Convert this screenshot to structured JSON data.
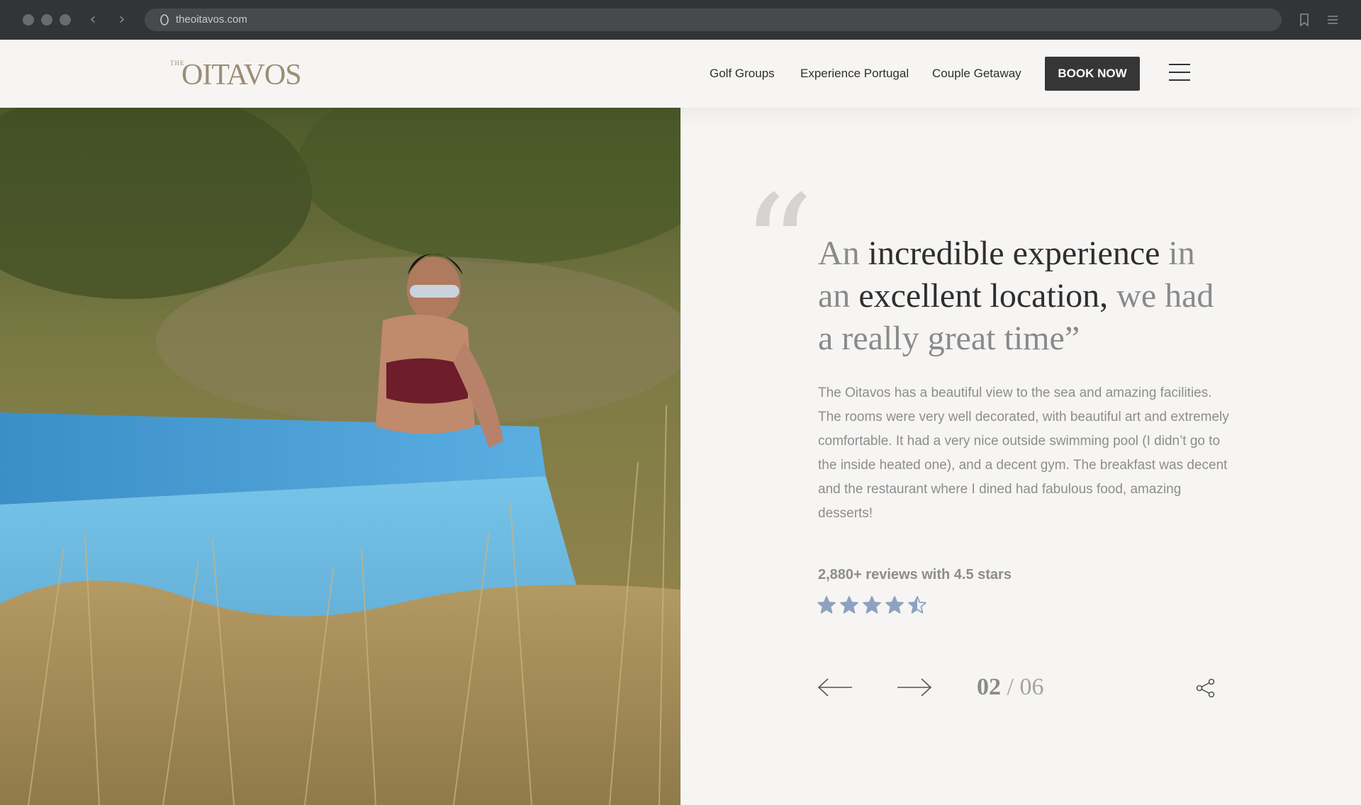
{
  "browser": {
    "url": "theoitavos.com"
  },
  "header": {
    "logo_small": "THE",
    "logo_main": "OITAVOS",
    "nav": [
      "Golf Groups",
      "Experience Portugal",
      "Couple Getaway"
    ],
    "book_label": "BOOK NOW"
  },
  "testimonial": {
    "quote_mark": "“",
    "quote_parts": [
      "An ",
      "incredible experience",
      " in an ",
      "excellent location,",
      " we had a really great time”"
    ],
    "review": "The Oitavos has a beautiful view to the sea and amazing facilities. The rooms were very well decorated, with beautiful art and extremely comfortable. It had a very nice outside swimming pool (I didn’t go to the inside heated one), and a decent gym. The breakfast was decent and the restaurant where I dined had fabulous food, amazing desserts!",
    "reviews_summary": "2,880+ reviews with 4.5 stars",
    "rating": 4.5,
    "rating_max": 5
  },
  "pager": {
    "current": "02",
    "separator": " / ",
    "total": "06"
  },
  "colors": {
    "accent": "#9b8e72",
    "button_bg": "#363636",
    "star": "#8ea2bf",
    "background": "#f6f5f3"
  },
  "icons": {
    "prev": "arrow-left-icon",
    "next": "arrow-right-icon",
    "share": "share-icon",
    "menu": "hamburger-icon"
  }
}
